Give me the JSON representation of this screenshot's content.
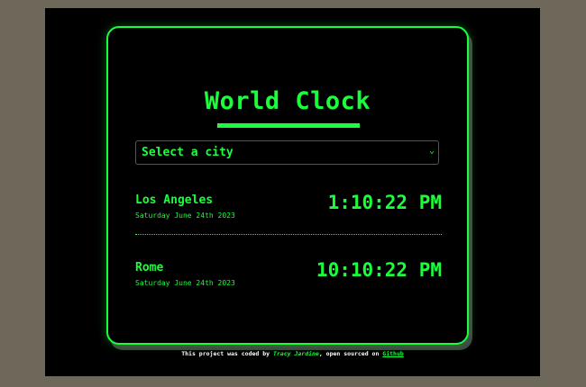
{
  "title": "World Clock",
  "select": {
    "placeholder": "Select a city",
    "chevron": "⌄"
  },
  "cities": [
    {
      "name": "Los Angeles",
      "date": "Saturday June 24th 2023",
      "time": "1:10:22 PM"
    },
    {
      "name": "Rome",
      "date": "Saturday June 24th 2023",
      "time": "10:10:22 PM"
    }
  ],
  "footer": {
    "prefix": "This project was coded by ",
    "author": "Tracy Jardine",
    "middle": ", open sourced on ",
    "link": "Github"
  },
  "colors": {
    "accent": "#1aff3c",
    "background": "#000000",
    "page": "#6e685b"
  }
}
